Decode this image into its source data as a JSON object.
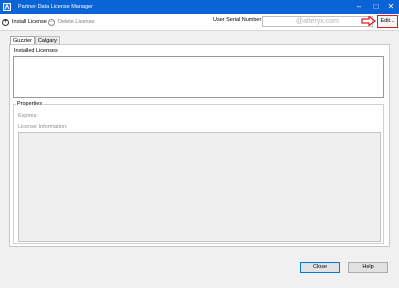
{
  "window": {
    "title": "Partner Data License Manager",
    "controls": {
      "minimize": "–",
      "maximize": "□",
      "close": "✕"
    }
  },
  "toolbar": {
    "install_label": "Install License",
    "install_icon": "plus-circle",
    "delete_label": "Delete License",
    "delete_icon": "minus-circle",
    "serial_label": "User Serial Number",
    "serial_value": "@alteryx.com",
    "edit_label": "Edit..."
  },
  "tabs": [
    {
      "label": "Guzzler",
      "active": true
    },
    {
      "label": "Calgary",
      "active": false
    }
  ],
  "installed": {
    "label": "Installed Licenses"
  },
  "properties": {
    "title": "Properties",
    "expires_label": "Expires:",
    "license_info_label": "License Information:"
  },
  "footer": {
    "close_label": "Close",
    "help_label": "Help"
  },
  "colors": {
    "titlebar": "#0a64d6",
    "highlight": "#e0191f"
  }
}
